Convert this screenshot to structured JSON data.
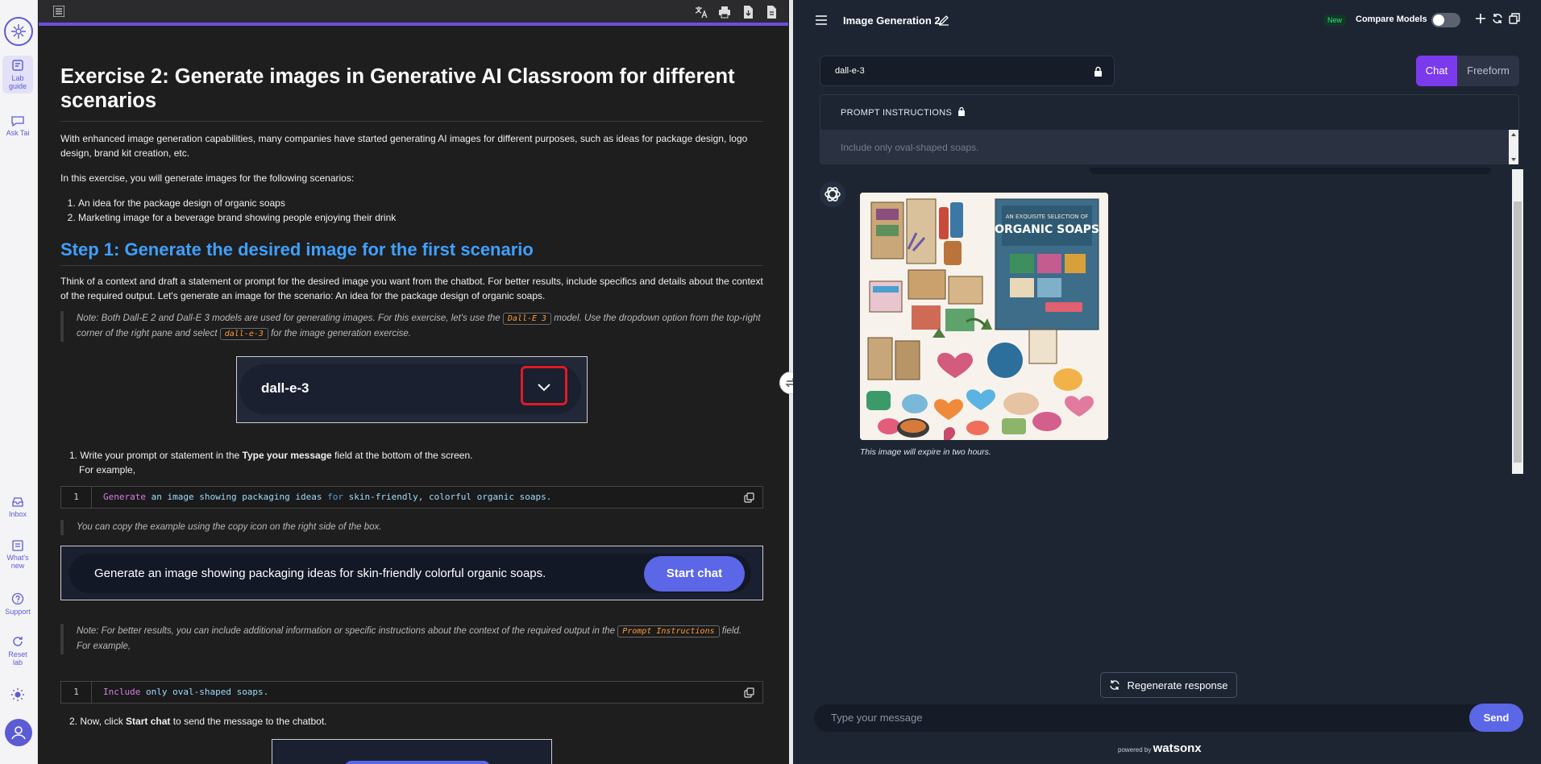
{
  "rail": {
    "items": [
      {
        "label": "Lab guide"
      },
      {
        "label": "Ask Tai"
      },
      {
        "label": "Inbox"
      },
      {
        "label": "What's new"
      },
      {
        "label": "Support"
      },
      {
        "label": "Reset lab"
      }
    ]
  },
  "guide": {
    "title": "Exercise 2: Generate images in Generative AI Classroom for different scenarios",
    "intro": "With enhanced image generation capabilities, many companies have started generating AI images for different purposes, such as ideas for package design, logo design, brand kit creation, etc.",
    "scenarios_intro": "In this exercise, you will generate images for the following scenarios:",
    "scenarios": [
      "An idea for the package design of organic soaps",
      "Marketing image for a beverage brand showing people enjoying their drink"
    ],
    "step1_heading": "Step 1: Generate the desired image for the first scenario",
    "step1_text": "Think of a context and draft a statement or prompt for the desired image you want from the chatbot. For better results, include specifics and details about the context of the required output. Let's generate an image for the scenario: An idea for the package design of organic soaps.",
    "note1_a": "Note: Both Dall-E 2 and Dall-E 3 models are used for generating images. For this exercise, let's use the ",
    "note1_code1": "Dall-E 3",
    "note1_b": " model. Use the dropdown option from the top-right corner of the right pane and select ",
    "note1_code2": "dall-e-3",
    "note1_c": " for the image generation exercise.",
    "shot1_model": "dall-e-3",
    "list1_a": "Write your prompt or statement in the ",
    "list1_bold": "Type your message",
    "list1_b": " field at the bottom of the screen.",
    "for_example": "For example,",
    "code1": {
      "line": "1",
      "w1": "Generate",
      "w2": " an image showing packaging ideas ",
      "w3": "for",
      "w4": " skin-friendly, colorful organic soaps."
    },
    "copy_note": "You can copy the example using the copy icon on the right side of the box.",
    "shot2_text": "Generate an image showing packaging ideas for skin-friendly colorful organic soaps.",
    "shot2_button": "Start chat",
    "note2_a": "Note: For better results, you can include additional information or specific instructions about the context of the required output in the ",
    "note2_code": "Prompt Instructions",
    "note2_b": " field.",
    "note2_example": "For example,",
    "code2": {
      "line": "1",
      "w1": "Include",
      "w2": " only oval-shaped soaps."
    },
    "list2_a": "Now, click ",
    "list2_bold": "Start chat",
    "list2_b": " to send the message to the chatbot."
  },
  "chat": {
    "title": "Image Generation 2",
    "new_badge": "New",
    "compare_label": "Compare Models",
    "compare_enabled": false,
    "model": "dall-e-3",
    "tabs": [
      "Chat",
      "Freeform"
    ],
    "active_tab": "Chat",
    "prompt_label": "PROMPT INSTRUCTIONS",
    "prompt_value": "Include only oval-shaped soaps.",
    "image_caption_top": "AN EXQUISITE SELECTION OF",
    "image_caption_main": "ORGANIC SOAPS",
    "expire_note": "This image will expire in two hours.",
    "regenerate_label": "Regenerate response",
    "input_placeholder": "Type your message",
    "send_label": "Send",
    "powered_by": "powered by",
    "brand": "watsonx"
  },
  "colors": {
    "accent": "#7c3aed",
    "heading_blue": "#3fa0ff",
    "send_button": "#5b67e6"
  }
}
